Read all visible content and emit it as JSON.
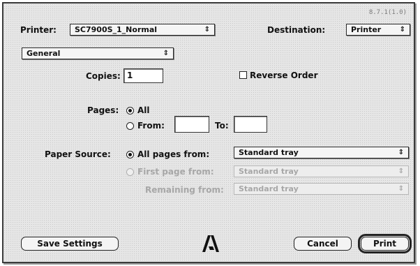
{
  "version": "8.7.1(1.0)",
  "printer": {
    "label": "Printer:",
    "value": "SC7900S_1_Normal",
    "arrow": "⇕"
  },
  "destination": {
    "label": "Destination:",
    "value": "Printer",
    "arrow": "⇕"
  },
  "panel": {
    "value": "General",
    "arrow": "⇕"
  },
  "copies": {
    "label": "Copies:",
    "value": "1"
  },
  "reverse_order": {
    "label": "Reverse Order",
    "checked": false
  },
  "pages": {
    "label": "Pages:",
    "all_label": "All",
    "from_label": "From:",
    "to_label": "To:",
    "from_value": "",
    "to_value": "",
    "selected": "All"
  },
  "paper_source": {
    "label": "Paper Source:",
    "all_pages_from_label": "All pages from:",
    "all_pages_from_value": "Standard tray",
    "first_page_from_label": "First page from:",
    "first_page_from_value": "Standard tray",
    "remaining_from_label": "Remaining from:",
    "remaining_from_value": "Standard tray",
    "arrow": "⇕"
  },
  "buttons": {
    "save_settings": "Save Settings",
    "cancel": "Cancel",
    "print": "Print"
  },
  "icons": {
    "logo": "adobe-logo-icon"
  }
}
